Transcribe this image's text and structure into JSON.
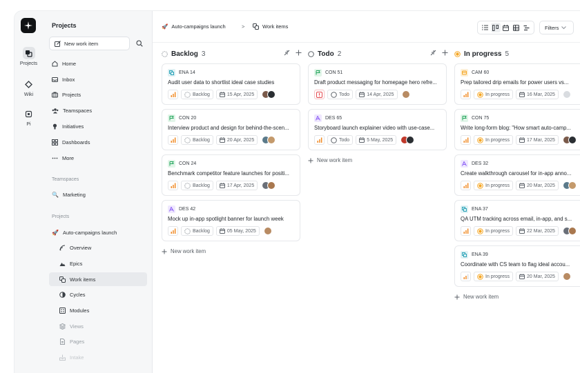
{
  "rail": {
    "items": [
      {
        "label": "Projects",
        "icon": "projects-icon"
      },
      {
        "label": "Wiki",
        "icon": "wiki-icon"
      },
      {
        "label": "Pi",
        "icon": "pi-icon"
      }
    ]
  },
  "sidebar": {
    "title": "Projects",
    "new_work_item": "New work item",
    "nav": [
      {
        "label": "Home",
        "icon": "home-icon"
      },
      {
        "label": "Inbox",
        "icon": "inbox-icon"
      },
      {
        "label": "Projects",
        "icon": "briefcase-icon"
      },
      {
        "label": "Teamspaces",
        "icon": "teamspaces-icon"
      },
      {
        "label": "Initiatives",
        "icon": "initiatives-icon"
      },
      {
        "label": "Dashboards",
        "icon": "dashboards-icon"
      },
      {
        "label": "More",
        "icon": "more-icon"
      }
    ],
    "teamspaces_label": "Teamspaces",
    "teamspace": {
      "label": "Marketing",
      "icon": "magnifier-emoji-icon"
    },
    "projects_label": "Projects",
    "project": {
      "label": "Auto-campaigns launch",
      "icon": "rocket-icon"
    },
    "project_nav": [
      {
        "label": "Overview",
        "icon": "overview-icon"
      },
      {
        "label": "Epics",
        "icon": "epics-icon"
      },
      {
        "label": "Work items",
        "icon": "work-items-icon"
      },
      {
        "label": "Cycles",
        "icon": "cycles-icon"
      },
      {
        "label": "Modules",
        "icon": "modules-icon"
      },
      {
        "label": "Views",
        "icon": "views-icon"
      },
      {
        "label": "Pages",
        "icon": "pages-icon"
      },
      {
        "label": "Intake",
        "icon": "intake-icon"
      }
    ]
  },
  "topbar": {
    "breadcrumb_project": "Auto-campaigns launch",
    "breadcrumb_sep": ">",
    "breadcrumb_page": "Work items",
    "filters_label": "Filters"
  },
  "colors": {
    "accent_orange": "#f08a24",
    "in_progress": "#f5a623",
    "con_green": "#22a55b",
    "des_purple": "#8a5cf6",
    "ena_teal": "#2aa3b8",
    "cam_orange": "#f5a623",
    "urgent_red": "#e5484d"
  },
  "board": {
    "add_label": "New work item",
    "columns": [
      {
        "title": "Backlog",
        "count": "3",
        "state_icon": "backlog-circle-icon",
        "cards": [
          {
            "id": "ENA 14",
            "type": "ena",
            "title": "Audit user data to shortlist ideal case studies",
            "priority": "medium",
            "state": "Backlog",
            "date": "15 Apr, 2025"
          },
          {
            "id": "CON 20",
            "type": "con",
            "title": "Interview product and design for behind-the-scen...",
            "priority": "medium",
            "state": "Backlog",
            "date": "20 Apr, 2025"
          },
          {
            "id": "CON 24",
            "type": "con",
            "title": "Benchmark competitor feature launches for positi...",
            "priority": "medium",
            "state": "Backlog",
            "date": "17 Apr, 2025"
          },
          {
            "id": "DES 42",
            "type": "des",
            "title": "Mock up in-app spotlight banner for launch week",
            "priority": "medium",
            "state": "Backlog",
            "date": "05 May, 2025"
          }
        ]
      },
      {
        "title": "Todo",
        "count": "2",
        "state_icon": "todo-circle-icon",
        "cards": [
          {
            "id": "CON 51",
            "type": "con",
            "title": "Draft product messaging for homepage hero refre...",
            "priority": "urgent",
            "state": "Todo",
            "date": "14 Apr, 2025"
          },
          {
            "id": "DES 65",
            "type": "des",
            "title": "Storyboard launch explainer video with use-case...",
            "priority": "medium",
            "state": "Todo",
            "date": "5 May, 2025"
          }
        ]
      },
      {
        "title": "In progress",
        "count": "5",
        "state_icon": "in-progress-circle-icon",
        "cards": [
          {
            "id": "CAM 60",
            "type": "cam",
            "title": "Prep tailored drip emails for power users vs...",
            "priority": "medium",
            "state": "In progress",
            "date": "16 Mar, 2025"
          },
          {
            "id": "CON 75",
            "type": "con",
            "title": "Write long-form blog: \"How smart auto-camp...",
            "priority": "medium",
            "state": "In progress",
            "date": "17 Mar, 2025"
          },
          {
            "id": "DES 32",
            "type": "des",
            "title": "Create walkthrough carousel for in-app anno...",
            "priority": "medium",
            "state": "In progress",
            "date": "20 Mar, 2025"
          },
          {
            "id": "ENA 37",
            "type": "ena",
            "title": "QA UTM tracking across email, in-app, and s...",
            "priority": "medium",
            "state": "In progress",
            "date": "22 Mar, 2025"
          },
          {
            "id": "ENA 39",
            "type": "ena",
            "title": "Coordinate with CS team to flag ideal accou...",
            "priority": "low",
            "state": "In progress",
            "date": "20 Mar, 2025"
          }
        ]
      }
    ]
  }
}
